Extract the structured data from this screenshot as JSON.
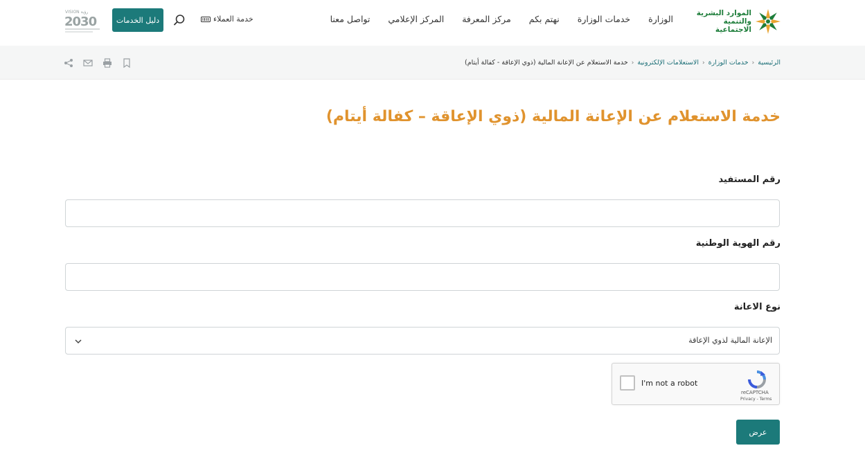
{
  "header": {
    "logo_line1": "الموارد البشرية",
    "logo_line2": "والتنمية الاجتماعية",
    "nav": [
      "الوزارة",
      "خدمات الوزارة",
      "نهتم بكم",
      "مركز المعرفة",
      "المركز الإعلامي",
      "تواصل معنا"
    ],
    "customer_service": "خدمة العملاء",
    "services_guide": "دليل الخدمات",
    "vision_top": "VISION رؤية",
    "vision_year": "2030"
  },
  "breadcrumb": {
    "items": [
      "الرئيسية",
      "خدمات الوزارة",
      "الاستعلامات الإلكترونية"
    ],
    "current": "خدمة الاستعلام عن الإعانة المالية (ذوي الإعاقة - كفالة أيتام)"
  },
  "page": {
    "title": "خدمة الاستعلام عن الإعانة المالية (ذوي الإعاقة – كفالة أيتام)"
  },
  "form": {
    "beneficiary_label": "رقم المستفيد",
    "national_id_label": "رقم الهوية الوطنية",
    "aid_type_label": "نوع الاعانة",
    "aid_type_selected": "الإعانة المالية لذوي الإعاقة",
    "submit": "عرض"
  },
  "captcha": {
    "label": "I'm not a robot",
    "brand": "reCAPTCHA",
    "terms": "Privacy - Terms"
  },
  "colors": {
    "accent_teal": "#1c7a7a",
    "title_orange": "#e0932e",
    "logo_green": "#1d7d3a"
  }
}
